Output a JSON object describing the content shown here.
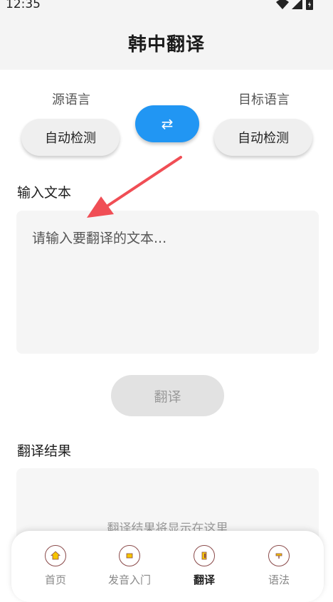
{
  "status_bar": {
    "time": "12:35",
    "icons": [
      "wifi-icon",
      "cellular-icon",
      "battery-icon"
    ]
  },
  "header": {
    "title": "韩中翻译"
  },
  "languages": {
    "source_label": "源语言",
    "source_value": "自动检测",
    "swap_glyph": "⇄",
    "target_label": "目标语言",
    "target_value": "自动检测"
  },
  "input": {
    "label": "输入文本",
    "placeholder": "请输入要翻译的文本..."
  },
  "translate_button": "翻译",
  "result": {
    "label": "翻译结果",
    "placeholder": "翻译结果将显示在这里"
  },
  "bottom_nav": {
    "items": [
      {
        "label": "首页",
        "icon": "home-icon"
      },
      {
        "label": "发音入门",
        "icon": "pronunciation-icon"
      },
      {
        "label": "翻译",
        "icon": "translate-icon",
        "active": true
      },
      {
        "label": "语法",
        "icon": "grammar-icon"
      }
    ]
  },
  "colors": {
    "accent": "#2196f3",
    "annotation_arrow": "#f04e55",
    "nav_icon_fill": "#f5c400",
    "nav_icon_border": "#8a4a4a"
  }
}
